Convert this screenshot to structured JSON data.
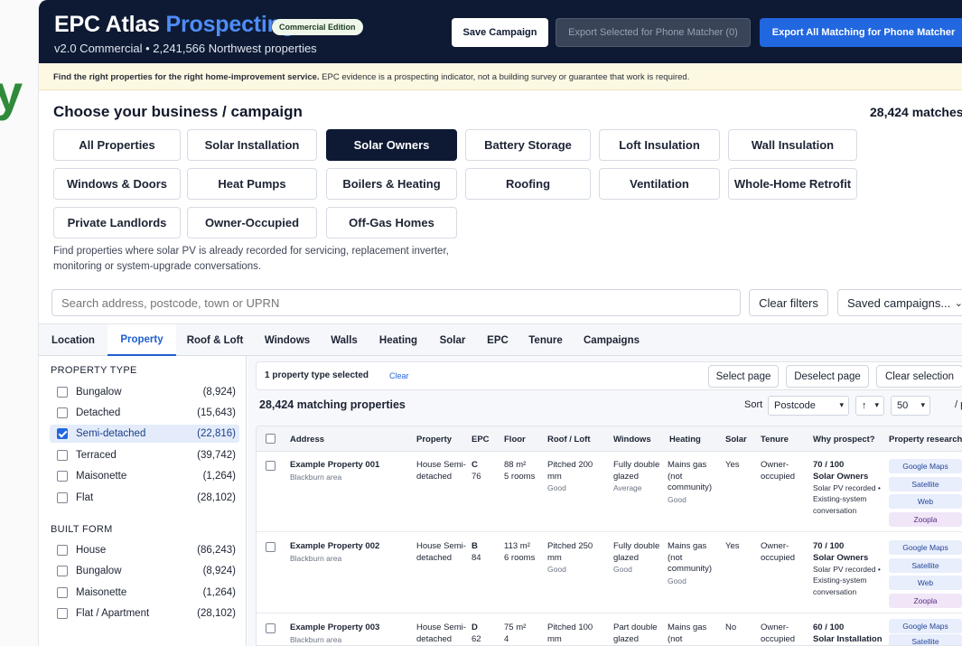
{
  "header": {
    "title_main": "EPC Atlas",
    "title_accent": "Prospecting",
    "edition_badge": "Commercial Edition",
    "subtitle": "v2.0 Commercial  •  2,241,566 Northwest properties",
    "save_button": "Save Campaign",
    "export_selected_button": "Export Selected for Phone Matcher (0)",
    "export_all_button": "Export All Matching for Phone Matcher"
  },
  "banner": {
    "bold": "Find the right properties for the right home-improvement service.",
    "text": " EPC evidence is a prospecting indicator, not a building survey or guarantee that work is required."
  },
  "campaign": {
    "heading": "Choose your business / campaign",
    "matches": "28,424 matches",
    "buttons": [
      "All Properties",
      "Solar Installation",
      "Solar Owners",
      "Battery Storage",
      "Loft Insulation",
      "Wall Insulation",
      "Windows & Doors",
      "Heat Pumps",
      "Boilers & Heating",
      "Roofing",
      "Ventilation",
      "Whole-Home Retrofit",
      "Private Landlords",
      "Owner-Occupied",
      "Off-Gas Homes"
    ],
    "active": "Solar Owners",
    "description": "Find properties where solar PV is already recorded for servicing, replacement inverter, monitoring or system-upgrade conversations."
  },
  "search": {
    "placeholder": "Search address, postcode, town or UPRN",
    "clear_filters": "Clear filters",
    "saved_campaigns": "Saved campaigns..."
  },
  "tabs": [
    "Location",
    "Property",
    "Roof & Loft",
    "Windows",
    "Walls",
    "Heating",
    "Solar",
    "EPC",
    "Tenure",
    "Campaigns"
  ],
  "active_tab": "Property",
  "sidebar": {
    "property_type_heading": "PROPERTY TYPE",
    "property_types": [
      {
        "label": "Bungalow",
        "count": "(8,924)",
        "checked": false
      },
      {
        "label": "Detached",
        "count": "(15,643)",
        "checked": false
      },
      {
        "label": "Semi-detached",
        "count": "(22,816)",
        "checked": true
      },
      {
        "label": "Terraced",
        "count": "(39,742)",
        "checked": false
      },
      {
        "label": "Maisonette",
        "count": "(1,264)",
        "checked": false
      },
      {
        "label": "Flat",
        "count": "(28,102)",
        "checked": false
      }
    ],
    "built_form_heading": "BUILT FORM",
    "built_forms": [
      {
        "label": "House",
        "count": "(86,243)",
        "checked": false
      },
      {
        "label": "Bungalow",
        "count": "(8,924)",
        "checked": false
      },
      {
        "label": "Maisonette",
        "count": "(1,264)",
        "checked": false
      },
      {
        "label": "Flat / Apartment",
        "count": "(28,102)",
        "checked": false
      }
    ]
  },
  "results": {
    "selection_text": "1 property type selected",
    "clear_link": "Clear",
    "select_page": "Select page",
    "deselect_page": "Deselect page",
    "clear_selection": "Clear selection",
    "count_text": "28,424 matching properties",
    "sort_label": "Sort",
    "sort_value": "Postcode",
    "sort_dir": "↑",
    "page_size": "50",
    "per_page_label": "/ page",
    "columns": [
      "Address",
      "Property",
      "EPC",
      "Floor",
      "Roof / Loft",
      "Windows",
      "Heating",
      "Solar",
      "Tenure",
      "Why prospect?",
      "Property research"
    ],
    "research_buttons": [
      "Google Maps",
      "Satellite",
      "Web",
      "Zoopla"
    ],
    "rows": [
      {
        "address": "Example Property 001",
        "area": "Blackburn area",
        "property": "House Semi-detached",
        "epc_band": "C",
        "epc_score": "76",
        "floor": "88 m²",
        "rooms": "5 rooms",
        "roof": "Pitched 200 mm",
        "roof_q": "Good",
        "windows": "Fully double glazed",
        "windows_q": "Average",
        "heating": "Mains gas (not community)",
        "heating_q": "Good",
        "solar": "Yes",
        "tenure": "Owner-occupied",
        "score": "70 / 100",
        "campaign": "Solar Owners",
        "reason": "Solar PV recorded • Existing-system conversation"
      },
      {
        "address": "Example Property 002",
        "area": "Blackburn area",
        "property": "House Semi-detached",
        "epc_band": "B",
        "epc_score": "84",
        "floor": "113 m²",
        "rooms": "6 rooms",
        "roof": "Pitched 250 mm",
        "roof_q": "Good",
        "windows": "Fully double glazed",
        "windows_q": "Good",
        "heating": "Mains gas (not community)",
        "heating_q": "Good",
        "solar": "Yes",
        "tenure": "Owner-occupied",
        "score": "70 / 100",
        "campaign": "Solar Owners",
        "reason": "Solar PV recorded • Existing-system conversation"
      },
      {
        "address": "Example Property 003",
        "area": "Blackburn area",
        "property": "House Semi-detached",
        "epc_band": "D",
        "epc_score": "62",
        "floor": "75 m²",
        "rooms": "4",
        "roof": "Pitched 100 mm",
        "roof_q": "",
        "windows": "Part double glazed",
        "windows_q": "",
        "heating": "Mains gas (not",
        "heating_q": "",
        "solar": "No",
        "tenure": "Owner-occupied",
        "score": "60 / 100",
        "campaign": "Solar Installation",
        "reason": ""
      }
    ]
  },
  "colors": {
    "header_bg": "#0e1a33",
    "accent": "#4f8df7",
    "primary_button": "#2167e0",
    "banner_bg": "#fdf8e2"
  }
}
